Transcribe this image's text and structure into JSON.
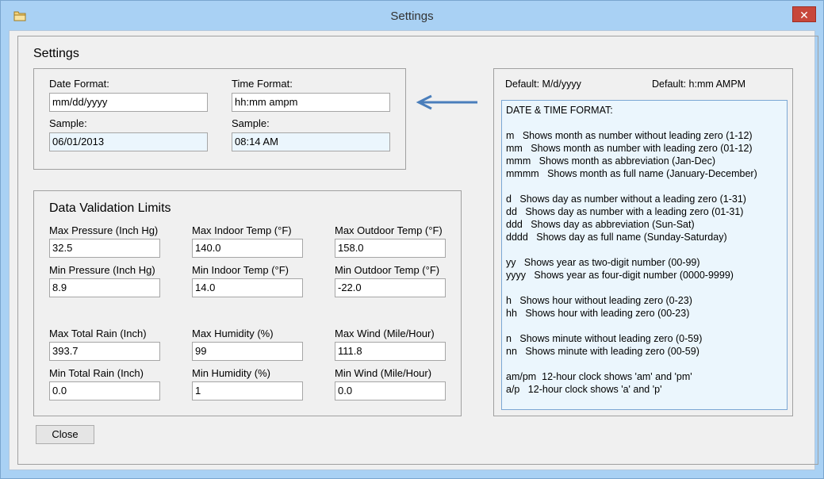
{
  "window": {
    "title": "Settings",
    "close_glyph": "✕",
    "app_icon": "folder-icon"
  },
  "settings_section": {
    "title": "Settings",
    "date_format_label": "Date Format:",
    "date_format_value": "mm/dd/yyyy",
    "date_sample_label": "Sample:",
    "date_sample_value": "06/01/2013",
    "time_format_label": "Time Format:",
    "time_format_value": "hh:mm ampm",
    "time_sample_label": "Sample:",
    "time_sample_value": "08:14 AM"
  },
  "arrow": {
    "icon": "left-arrow-icon",
    "color": "#4a7ebb"
  },
  "validation": {
    "title": "Data Validation Limits",
    "fields": [
      {
        "label": "Max Pressure (Inch Hg)",
        "value": "32.5"
      },
      {
        "label": "Max Indoor Temp (°F)",
        "value": "140.0"
      },
      {
        "label": "Max Outdoor Temp (°F)",
        "value": "158.0"
      },
      {
        "label": "Min Pressure (Inch Hg)",
        "value": "8.9"
      },
      {
        "label": "Min Indoor Temp (°F)",
        "value": "14.0"
      },
      {
        "label": "Min Outdoor Temp (°F)",
        "value": "-22.0"
      },
      {
        "label": "Max Total Rain (Inch)",
        "value": "393.7"
      },
      {
        "label": "Max Humidity (%)",
        "value": "99"
      },
      {
        "label": "Max Wind (Mile/Hour)",
        "value": "111.8"
      },
      {
        "label": "Min Total Rain (Inch)",
        "value": "0.0"
      },
      {
        "label": "Min Humidity (%)",
        "value": "1"
      },
      {
        "label": "Min Wind (Mile/Hour)",
        "value": "0.0"
      }
    ]
  },
  "help": {
    "default_date": "Default: M/d/yyyy",
    "default_time": "Default: h:mm AMPM",
    "lines": [
      "DATE & TIME FORMAT:",
      "",
      "m   Shows month as number without leading zero (1-12)",
      "mm   Shows month as number with leading zero (01-12)",
      "mmm   Shows month as abbreviation (Jan-Dec)",
      "mmmm   Shows month as full name (January-December)",
      "",
      "d   Shows day as number without a leading zero (1-31)",
      "dd   Shows day as number with a leading zero (01-31)",
      "ddd   Shows day as abbreviation (Sun-Sat)",
      "dddd   Shows day as full name (Sunday-Saturday)",
      "",
      "yy   Shows year as two-digit number (00-99)",
      "yyyy   Shows year as four-digit number (0000-9999)",
      "",
      "h   Shows hour without leading zero (0-23)",
      "hh   Shows hour with leading zero (00-23)",
      "",
      "n   Shows minute without leading zero (0-59)",
      "nn   Shows minute with leading zero (00-59)",
      "",
      "am/pm  12-hour clock shows 'am' and 'pm'",
      "a/p   12-hour clock shows 'a' and 'p'"
    ]
  },
  "footer": {
    "close_label": "Close"
  }
}
